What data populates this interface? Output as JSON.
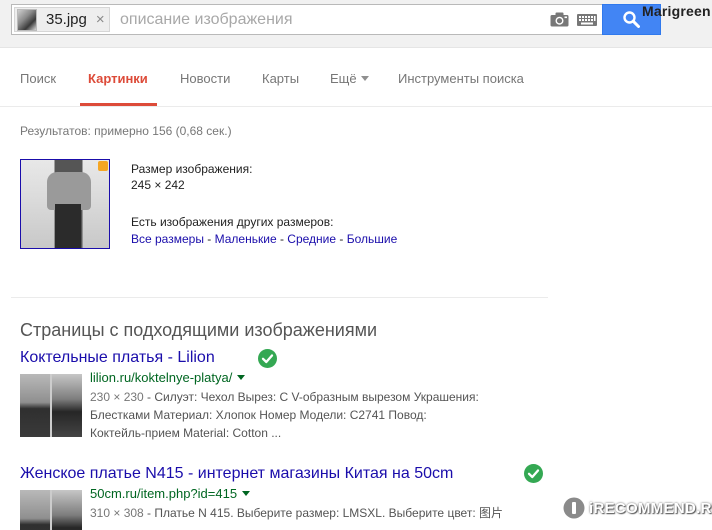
{
  "search": {
    "chip_filename": "35.jpg",
    "chip_close": "×",
    "input_value": "",
    "placeholder": "описание изображения",
    "button_icon": "search-icon",
    "camera_icon": "camera-icon",
    "keyboard_icon": "keyboard-icon"
  },
  "user": {
    "name": "Marigreen"
  },
  "tabs": [
    {
      "label": "Поиск",
      "active": false
    },
    {
      "label": "Картинки",
      "active": true
    },
    {
      "label": "Новости",
      "active": false
    },
    {
      "label": "Карты",
      "active": false
    },
    {
      "label": "Ещё",
      "active": false
    },
    {
      "label": "Инструменты поиска",
      "active": false
    }
  ],
  "stats": "Результатов: примерно 156 (0,68 сек.)",
  "image_info": {
    "size_label": "Размер изображения:",
    "size_value": "245 × 242",
    "other_sizes_label": "Есть изображения других размеров:",
    "links": [
      "Все размеры",
      "Маленькие",
      "Средние",
      "Большие"
    ],
    "separator": " - "
  },
  "section_heading": "Страницы с подходящими изображениями",
  "results": [
    {
      "title": "Коктельные платья - Lilion",
      "url": "lilion.ru/koktelnye-platya/",
      "dims": "230 × 230",
      "snippet_lines": [
        " - Силуэт: Чехол Вырез: С V-образным вырезом Украшения:",
        "Блестками Материал: Хлопок Номер Модели: С2741 Повод:",
        "Коктейль-прием Material: Cotton ..."
      ],
      "verified_icon": "check-circle-icon"
    },
    {
      "title": "Женское платье N415 - интернет магазины Китая на 50cm",
      "url": "50cm.ru/item.php?id=415",
      "dims": "310 × 308",
      "snippet_lines": [
        " - Платье N 415. Выберите размер: LMSXL. Выберите цвет: 图片"
      ],
      "verified_icon": "check-circle-icon"
    }
  ],
  "watermark": {
    "text": "iRECOMMEND.RU"
  },
  "colors": {
    "link": "#1a0dab",
    "url_green": "#006621",
    "active_tab": "#dd4b39",
    "search_button": "#4285f4",
    "verified_green": "#34a853"
  }
}
